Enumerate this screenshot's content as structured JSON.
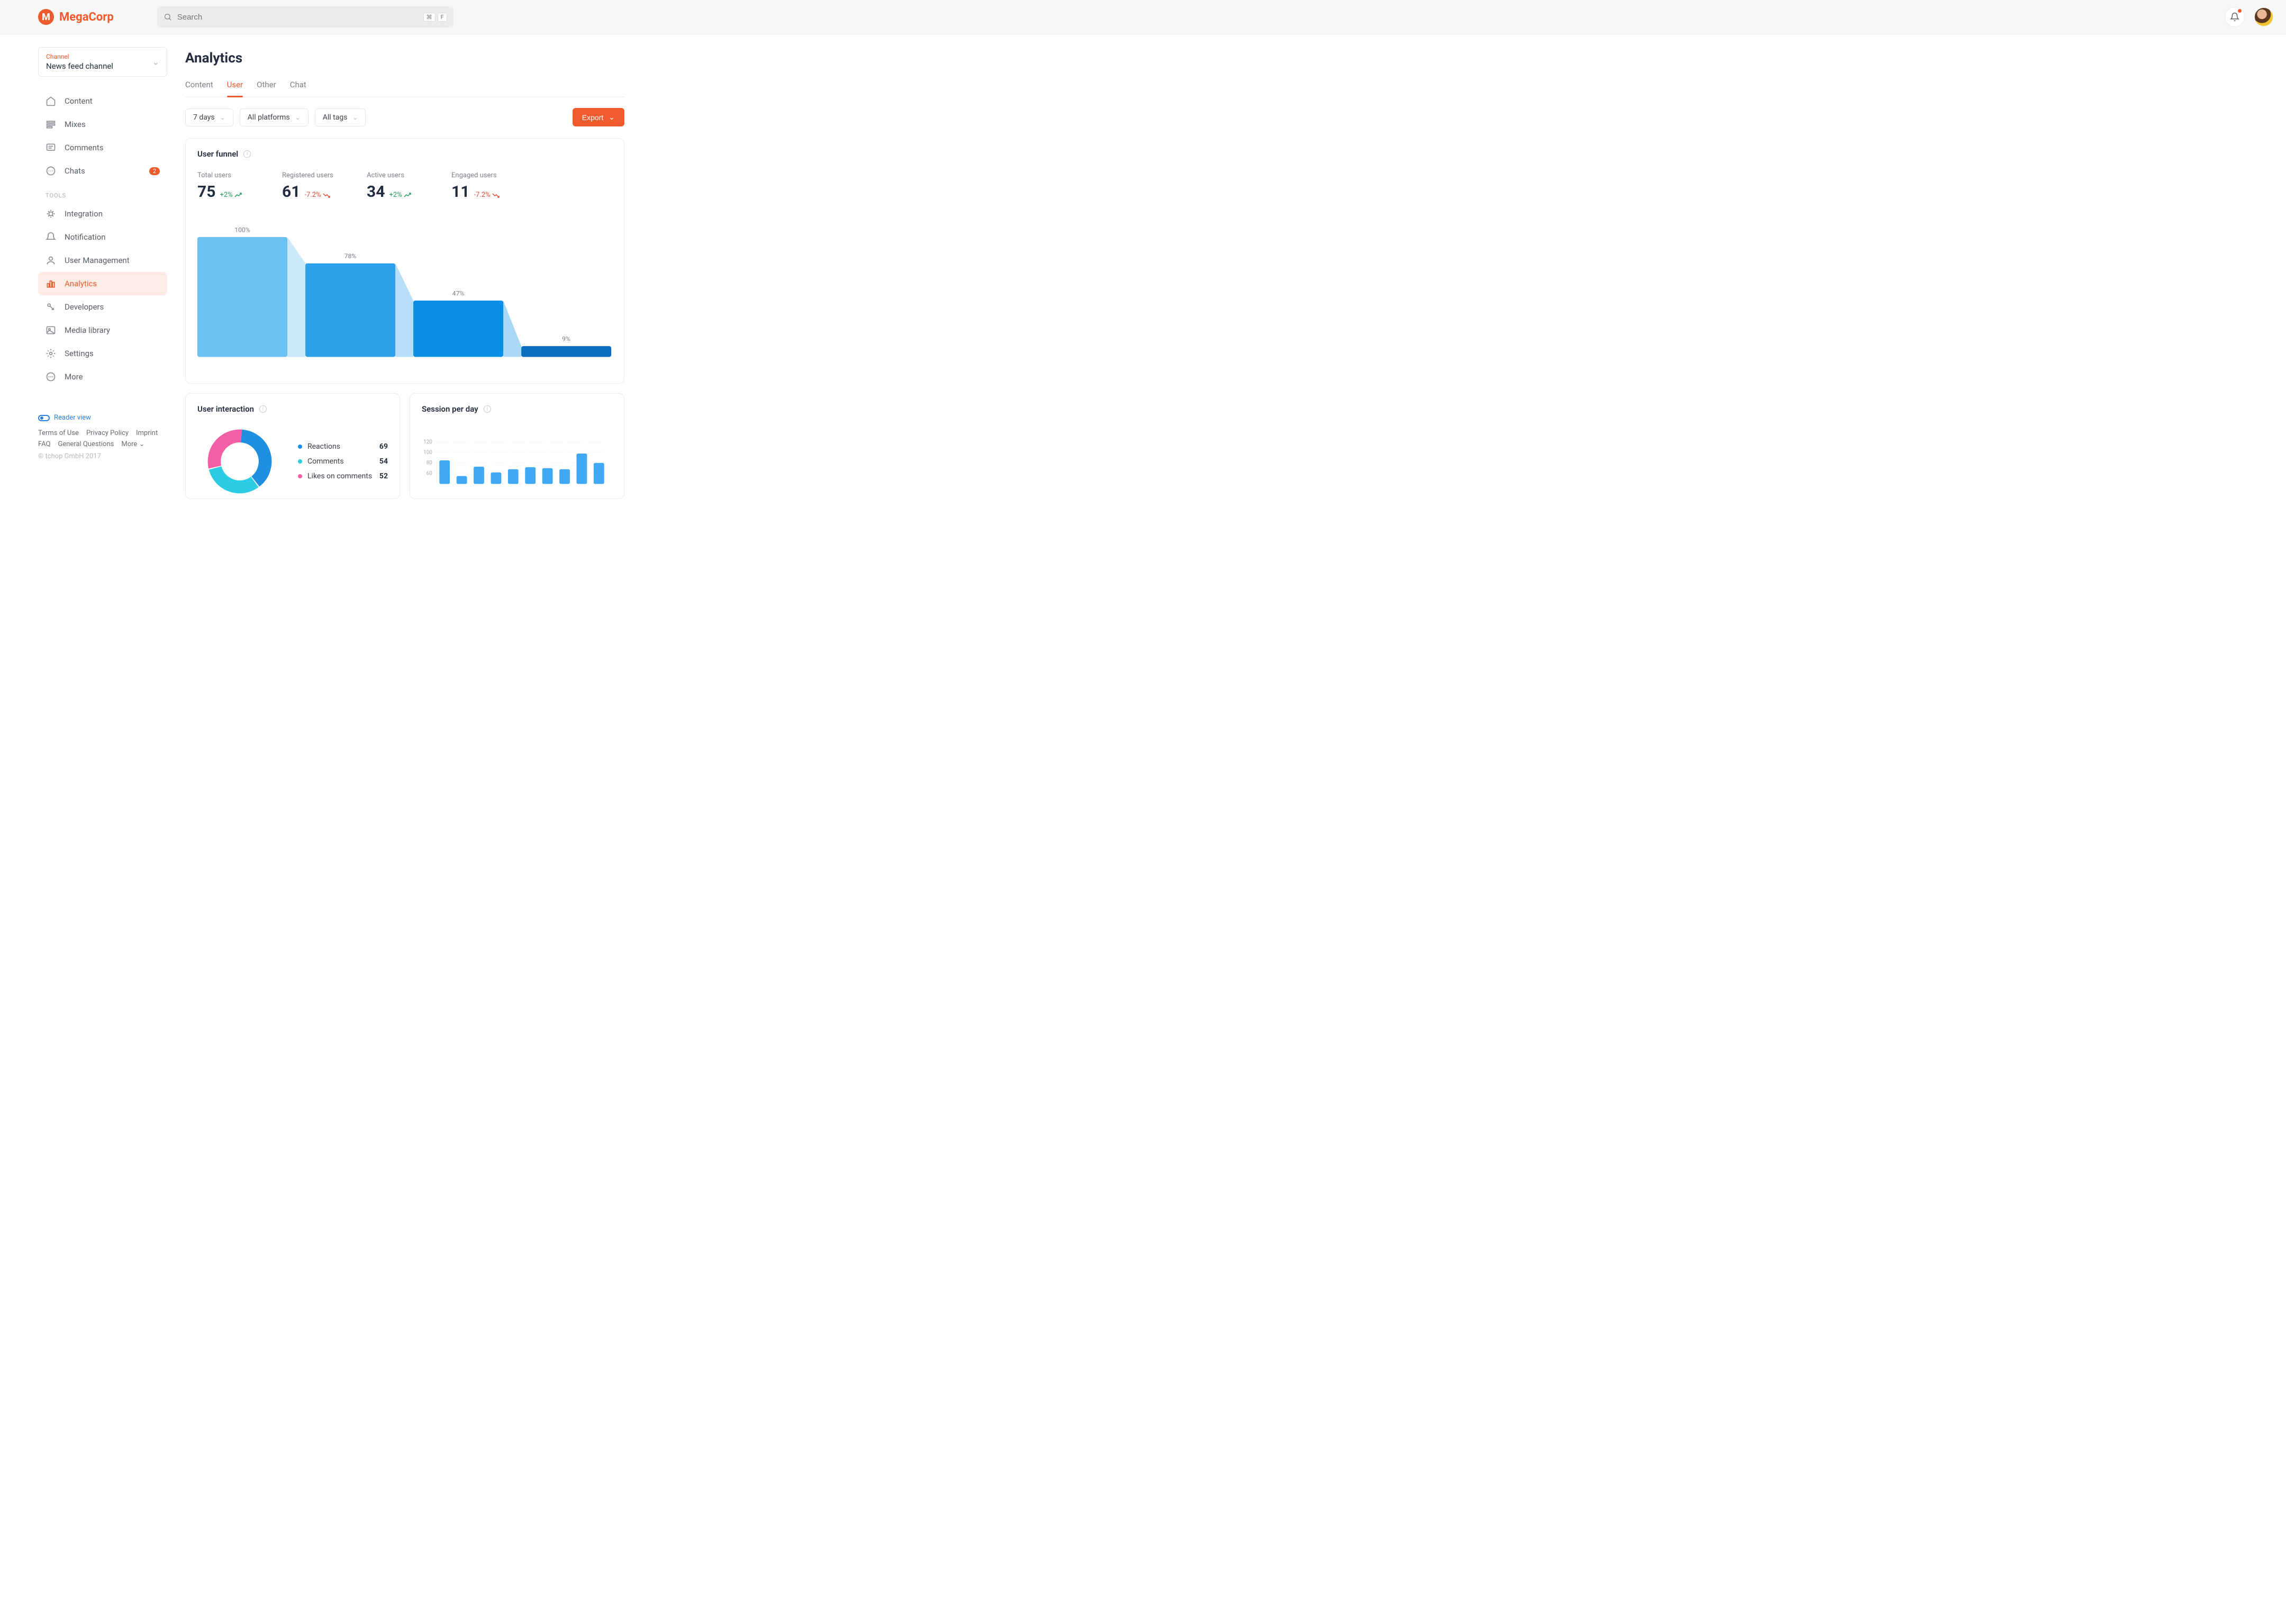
{
  "brand": "MegaCorp",
  "search": {
    "placeholder": "Search",
    "kbd1": "⌘",
    "kbd2": "F"
  },
  "channel": {
    "label": "Channel",
    "value": "News feed channel"
  },
  "nav": {
    "main": [
      {
        "label": "Content",
        "icon": "home"
      },
      {
        "label": "Mixes",
        "icon": "mixes"
      },
      {
        "label": "Comments",
        "icon": "comments"
      },
      {
        "label": "Chats",
        "icon": "chats",
        "badge": "2"
      }
    ],
    "tools_header": "TOOLS",
    "tools": [
      {
        "label": "Integration",
        "icon": "integration"
      },
      {
        "label": "Notification",
        "icon": "notification"
      },
      {
        "label": "User Management",
        "icon": "user"
      },
      {
        "label": "Analytics",
        "icon": "analytics",
        "active": true
      },
      {
        "label": "Developers",
        "icon": "developers"
      },
      {
        "label": "Media library",
        "icon": "media"
      },
      {
        "label": "Settings",
        "icon": "settings"
      },
      {
        "label": "More",
        "icon": "more"
      }
    ]
  },
  "reader_view": "Reader view",
  "footer_links": [
    "Terms of Use",
    "Privacy Policy",
    "Imprint",
    "FAQ",
    "General Questions",
    "More"
  ],
  "copyright": "© tchop GmbH 2017",
  "page_title": "Analytics",
  "tabs": [
    "Content",
    "User",
    "Other",
    "Chat"
  ],
  "active_tab": "User",
  "filters": {
    "range": "7 days",
    "platform": "All platforms",
    "tags": "All tags"
  },
  "export_label": "Export",
  "funnel": {
    "title": "User funnel",
    "stats": [
      {
        "label": "Total users",
        "value": "75",
        "delta": "+2%",
        "dir": "up"
      },
      {
        "label": "Registered users",
        "value": "61",
        "delta": "-7.2%",
        "dir": "down"
      },
      {
        "label": "Active users",
        "value": "34",
        "delta": "+2%",
        "dir": "up"
      },
      {
        "label": "Engaged users",
        "value": "11",
        "delta": "-7.2%",
        "dir": "down"
      }
    ]
  },
  "interaction": {
    "title": "User interaction",
    "items": [
      {
        "label": "Reactions",
        "value": "69",
        "color": "#1E8FE1"
      },
      {
        "label": "Comments",
        "value": "54",
        "color": "#1E8FE1"
      },
      {
        "label": "Likes on comments",
        "value": "52",
        "color": "#F35FA4"
      }
    ]
  },
  "session": {
    "title": "Session per day"
  },
  "chart_data": [
    {
      "type": "funnel",
      "title": "User funnel",
      "categories": [
        "Total users",
        "Registered users",
        "Active users",
        "Engaged users"
      ],
      "values_percent": [
        100,
        78,
        47,
        9
      ],
      "values_abs": [
        75,
        61,
        34,
        11
      ],
      "colors": [
        "#6BC1F2",
        "#2EA0EA",
        "#0A8FE6",
        "#0A6FC2"
      ]
    },
    {
      "type": "donut",
      "title": "User interaction",
      "series": [
        {
          "name": "Reactions",
          "value": 69,
          "color": "#1E8FE1"
        },
        {
          "name": "Comments",
          "value": 54,
          "color": "#2CCCE4"
        },
        {
          "name": "Likes on comments",
          "value": 52,
          "color": "#F35FA4"
        }
      ]
    },
    {
      "type": "bar",
      "title": "Session per day",
      "ylim": [
        0,
        140
      ],
      "yticks": [
        60,
        80,
        100,
        120
      ],
      "values": [
        85,
        55,
        73,
        62,
        68,
        72,
        70,
        68,
        98,
        80
      ]
    }
  ]
}
